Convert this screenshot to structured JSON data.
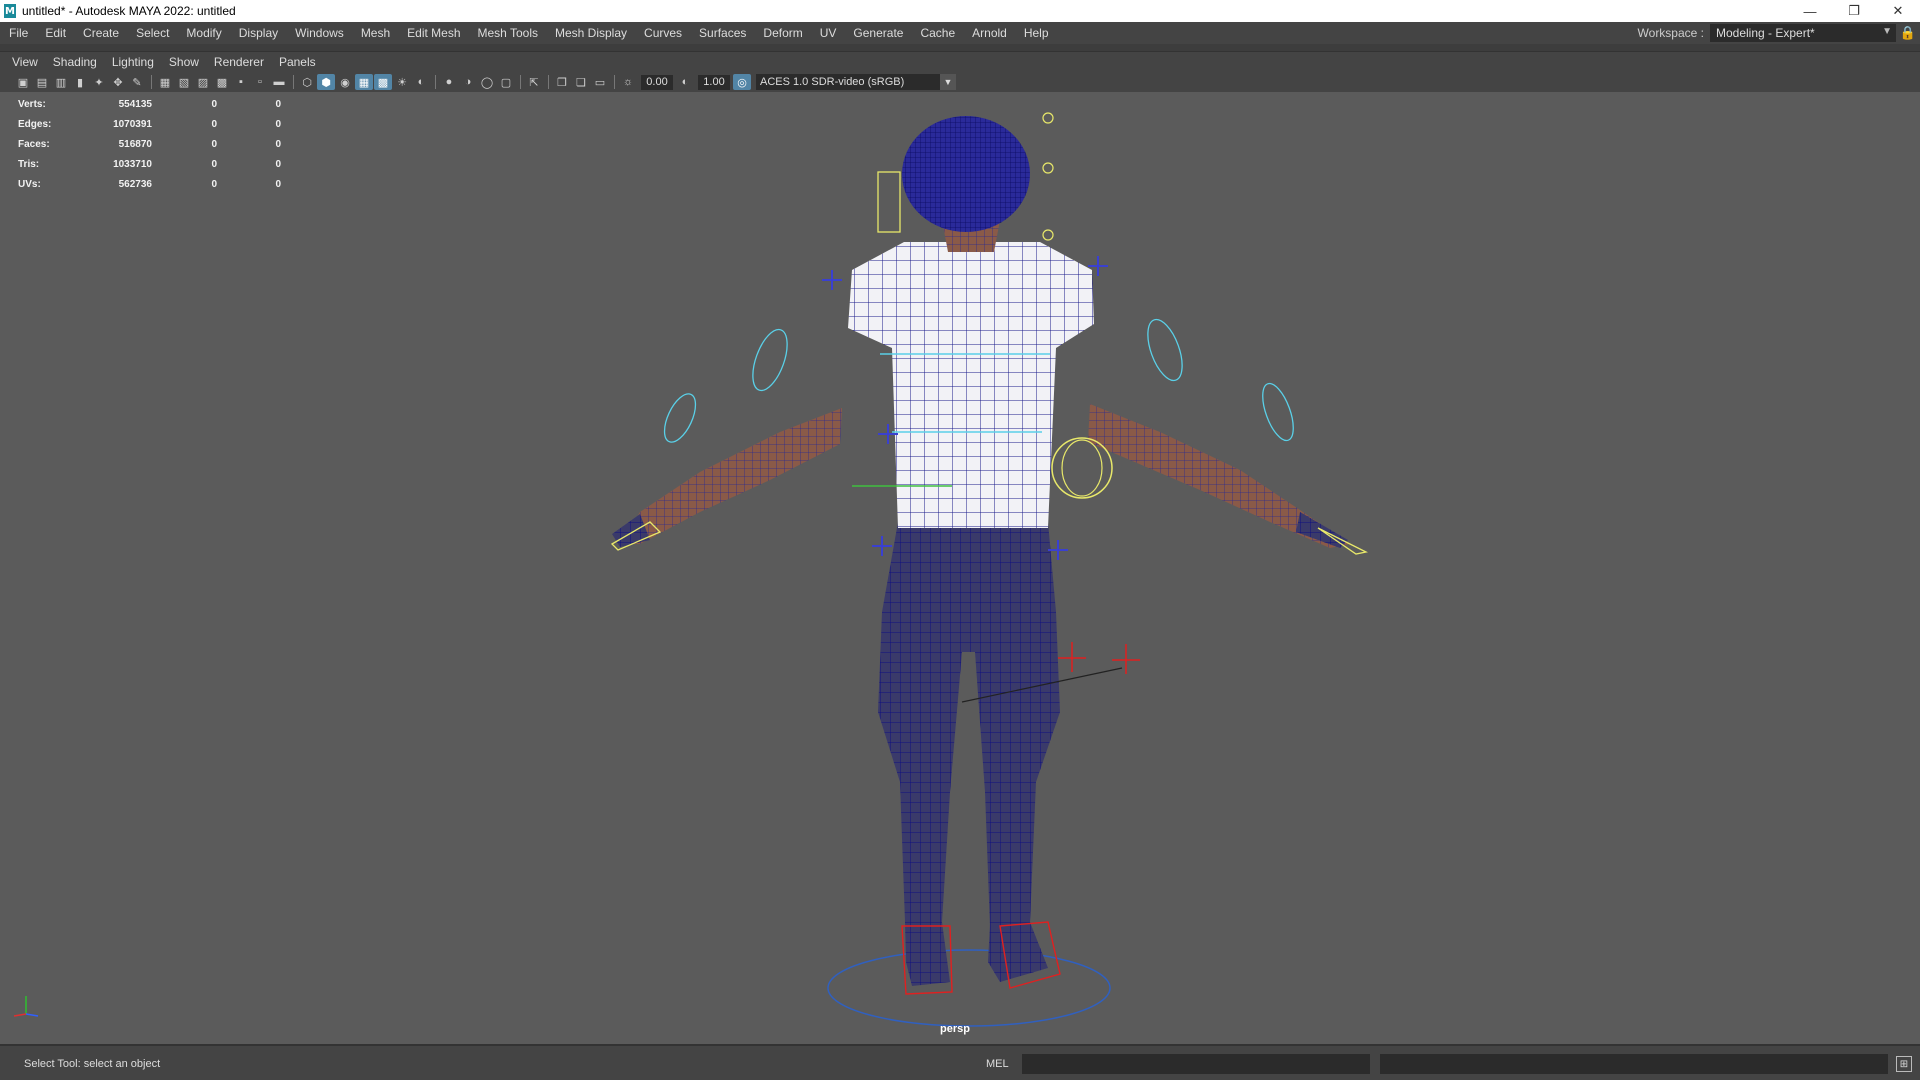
{
  "window": {
    "title": "untitled* - Autodesk MAYA 2022: untitled",
    "app_icon": "maya-icon",
    "controls": [
      "minimize-icon",
      "restore-icon",
      "close-icon"
    ]
  },
  "menubar": {
    "items": [
      "File",
      "Edit",
      "Create",
      "Select",
      "Modify",
      "Display",
      "Windows",
      "Mesh",
      "Edit Mesh",
      "Mesh Tools",
      "Mesh Display",
      "Curves",
      "Surfaces",
      "Deform",
      "UV",
      "Generate",
      "Cache",
      "Arnold",
      "Help"
    ],
    "workspace_label": "Workspace :",
    "workspace_value": "Modeling - Expert*"
  },
  "panel_menu": {
    "items": [
      "View",
      "Shading",
      "Lighting",
      "Show",
      "Renderer",
      "Panels"
    ]
  },
  "panel_toolbar": {
    "exposure": "0.00",
    "gamma": "1.00",
    "color_management": "ACES 1.0 SDR-video (sRGB)"
  },
  "hud": {
    "rows": [
      {
        "label": "Verts:",
        "value": "554135",
        "selected": "0",
        "uv_shell": "0"
      },
      {
        "label": "Edges:",
        "value": "1070391",
        "selected": "0",
        "uv_shell": "0"
      },
      {
        "label": "Faces:",
        "value": "516870",
        "selected": "0",
        "uv_shell": "0"
      },
      {
        "label": "Tris:",
        "value": "1033710",
        "selected": "0",
        "uv_shell": "0"
      },
      {
        "label": "UVs:",
        "value": "562736",
        "selected": "0",
        "uv_shell": "0"
      }
    ]
  },
  "viewport": {
    "camera": "persp",
    "background_color": "#5b5b5b",
    "wire_color": "#101080",
    "rig_color_cyan": "#5ad0e8",
    "rig_color_yellow": "#e8e86a",
    "rig_color_red": "#e02020"
  },
  "status": {
    "help_text": "Select Tool: select an object",
    "command_language": "MEL"
  }
}
